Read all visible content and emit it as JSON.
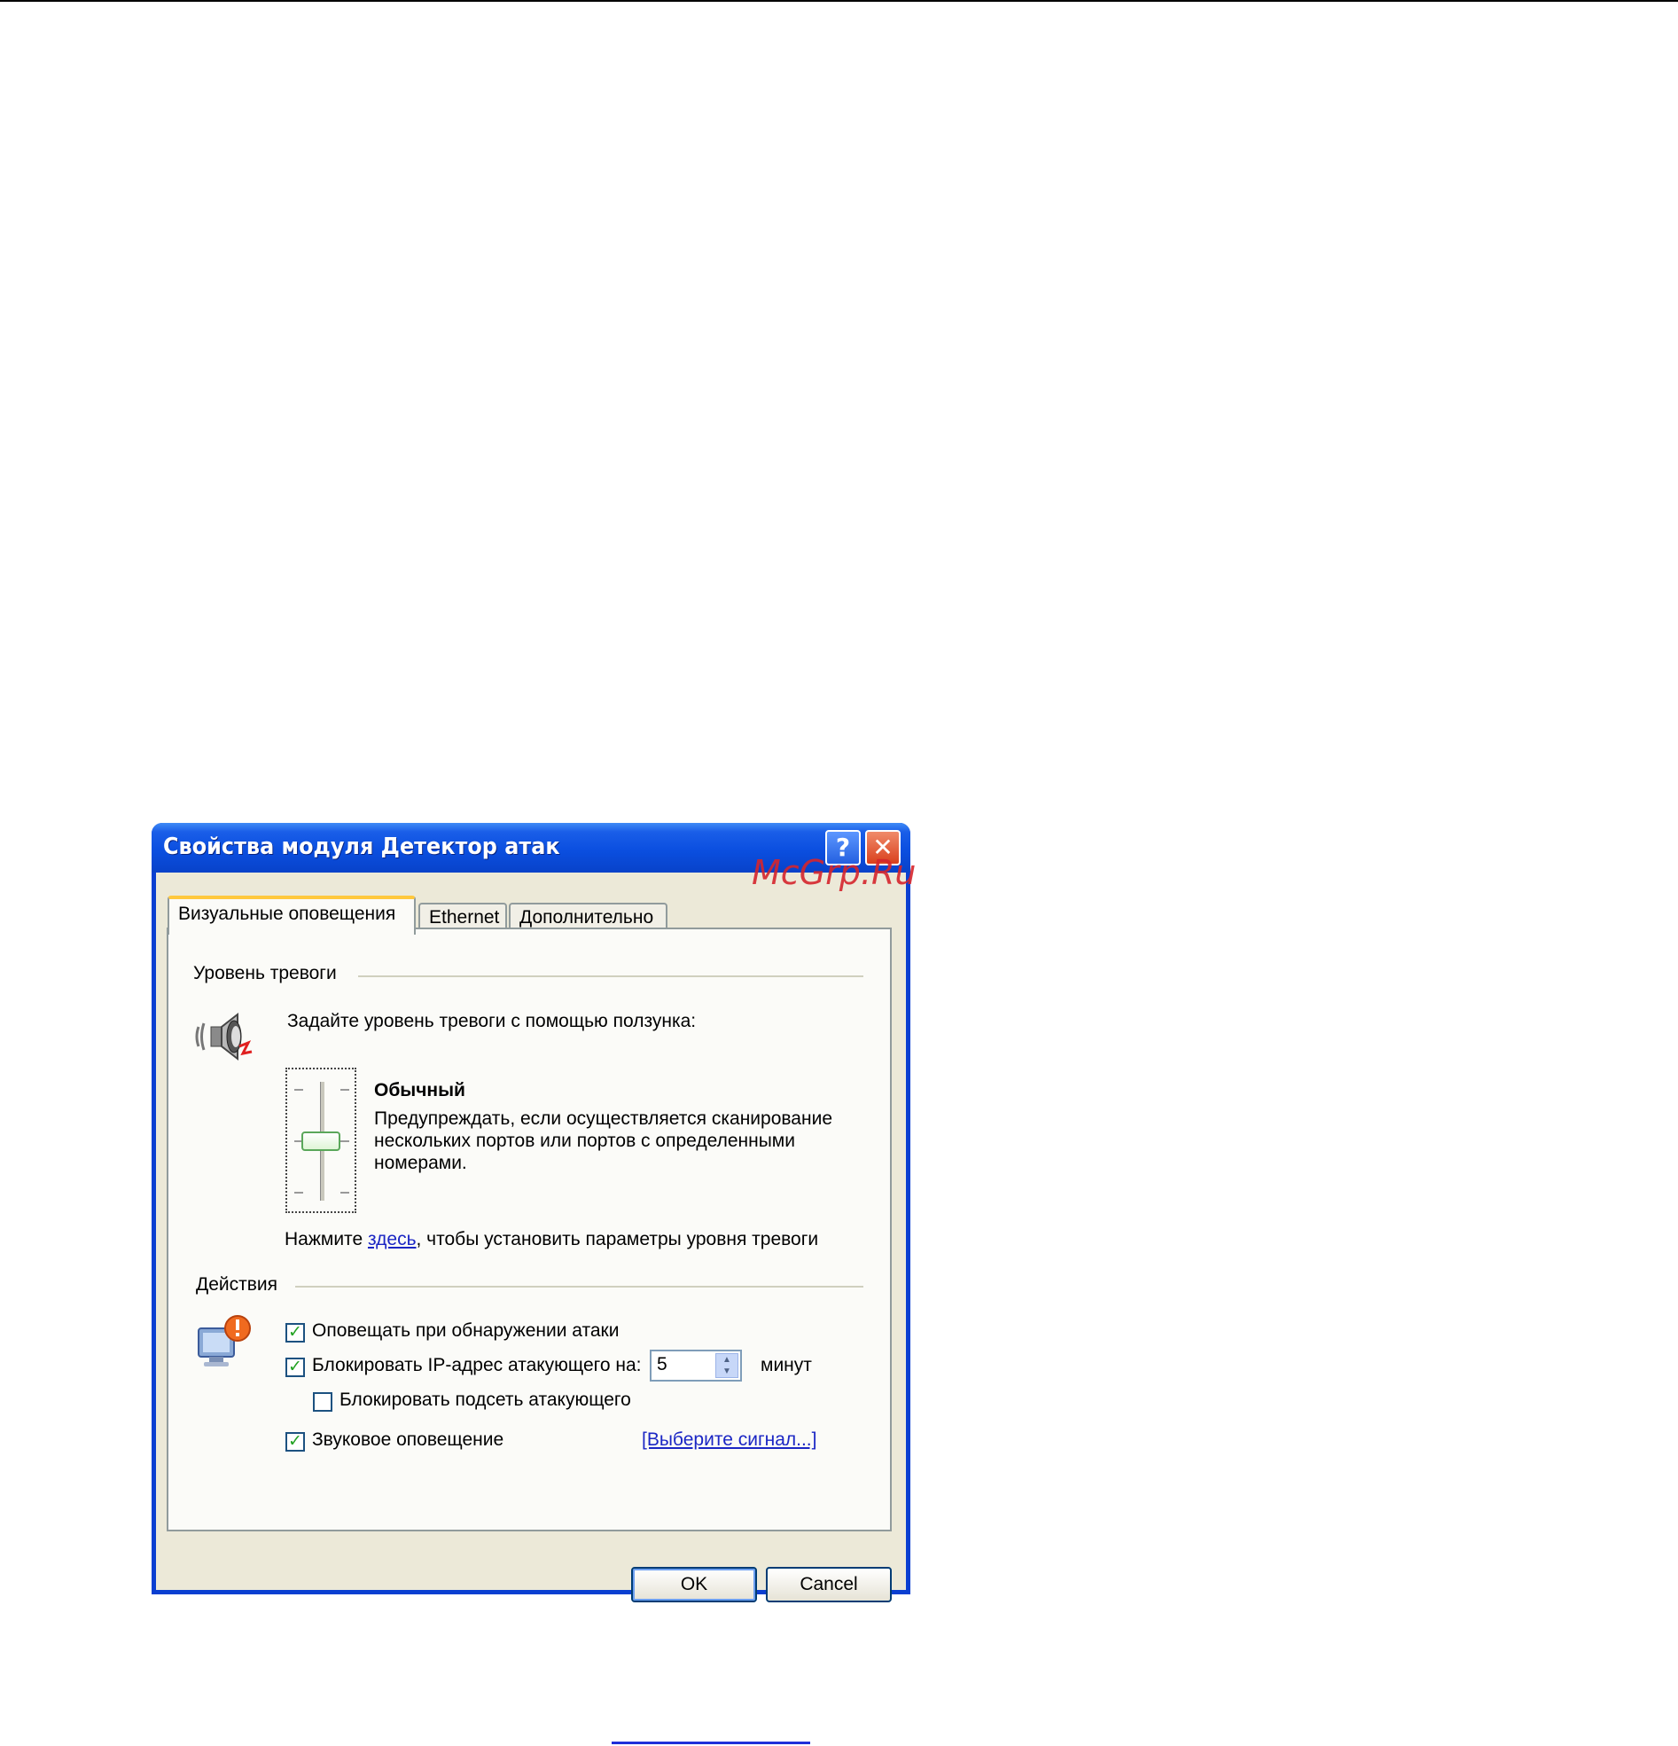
{
  "window": {
    "title": "Свойства модуля Детектор атак",
    "help_glyph": "?",
    "close_glyph": "✕"
  },
  "tabs": [
    {
      "label": "Визуальные оповещения",
      "active": true
    },
    {
      "label": "Ethernet",
      "active": false
    },
    {
      "label": "Дополнительно",
      "active": false
    }
  ],
  "alarm_level": {
    "group_title": "Уровень тревоги",
    "instruction": "Задайте уровень тревоги с помощью ползунка:",
    "level_name": "Обычный",
    "description_line1": "Предупреждать, если осуществляется сканирование",
    "description_line2": "нескольких портов или портов с определенными",
    "description_line3": "номерами.",
    "click_prefix": "Нажмите ",
    "click_link": "здесь",
    "click_suffix": ", чтобы установить параметры уровня тревоги",
    "slider_position": "middle"
  },
  "actions": {
    "group_title": "Действия",
    "notify_label": "Оповещать при обнаружении атаки",
    "notify_checked": true,
    "block_ip_label": "Блокировать IP-адрес атакующего на:",
    "block_ip_checked": true,
    "block_minutes_value": "5",
    "minutes_unit": "минут",
    "block_subnet_label": "Блокировать подсеть атакующего",
    "block_subnet_checked": false,
    "sound_label": "Звуковое оповещение",
    "sound_checked": true,
    "choose_signal_link": "[Выберите сигнал...]",
    "check_glyph": "✓"
  },
  "buttons": {
    "ok": "OK",
    "cancel": "Cancel"
  },
  "watermark": "McGrp.Ru",
  "colors": {
    "titlebar_blue": "#0b4fe0",
    "link_blue": "#1b26c4",
    "tab_highlight": "#ffc83d",
    "watermark_red": "#d5252d"
  },
  "icons": [
    "speaker-alert-icon",
    "computer-warning-icon",
    "help-icon",
    "close-icon"
  ]
}
